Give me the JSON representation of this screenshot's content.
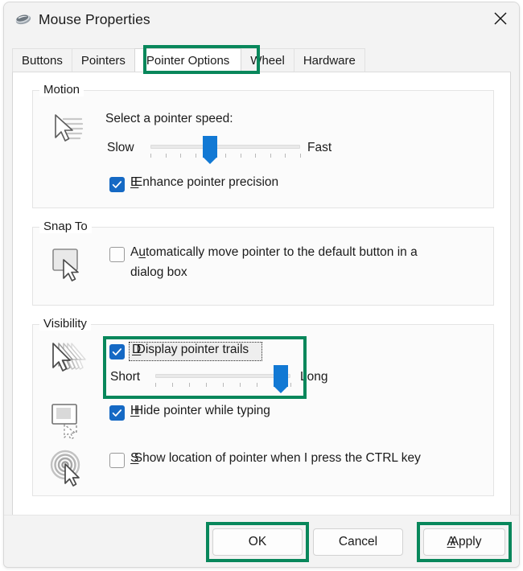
{
  "window": {
    "title": "Mouse Properties",
    "icon": "mouse-icon",
    "close_label": "Close"
  },
  "tabs": [
    {
      "label": "Buttons",
      "selected": false
    },
    {
      "label": "Pointers",
      "selected": false
    },
    {
      "label": "Pointer Options",
      "selected": true
    },
    {
      "label": "Wheel",
      "selected": false
    },
    {
      "label": "Hardware",
      "selected": false
    }
  ],
  "groups": {
    "motion": {
      "title": "Motion",
      "icon": "cursor-speed-icon",
      "speed_label": "Select a pointer speed:",
      "slider": {
        "min_label": "Slow",
        "max_label": "Fast",
        "value_percent": 40,
        "tick_count": 11
      },
      "enhance_precision": {
        "label": "Enhance pointer precision",
        "checked": true
      }
    },
    "snap_to": {
      "title": "Snap To",
      "icon": "snap-to-button-icon",
      "auto_move": {
        "label_line1": "Automatically move pointer to the default button in a",
        "label_line2": "dialog box",
        "checked": false
      }
    },
    "visibility": {
      "title": "Visibility",
      "trails_icon": "pointer-trails-icon",
      "display_trails": {
        "label": "Display pointer trails",
        "checked": true,
        "focused": true
      },
      "trails_slider": {
        "min_label": "Short",
        "max_label": "Long",
        "value_percent": 93,
        "tick_count": 9
      },
      "hide_typing": {
        "icon": "hide-pointer-typing-icon",
        "label": "Hide pointer while typing",
        "checked": true
      },
      "show_location": {
        "icon": "show-pointer-location-icon",
        "label": "Show location of pointer when I press the CTRL key",
        "checked": false
      }
    }
  },
  "footer": {
    "ok_label": "OK",
    "cancel_label": "Cancel",
    "apply_label": "Apply"
  },
  "annotations": {
    "highlight_color": "#08875b",
    "targets": [
      "Pointer Options tab",
      "Display pointer trails",
      "OK",
      "Apply"
    ]
  }
}
